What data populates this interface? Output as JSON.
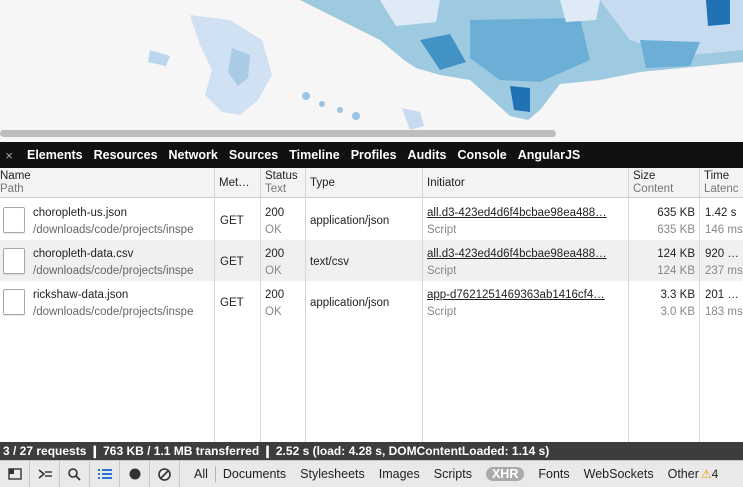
{
  "devtools": {
    "tabs": [
      "Elements",
      "Resources",
      "Network",
      "Sources",
      "Timeline",
      "Profiles",
      "Audits",
      "Console",
      "AngularJS"
    ],
    "close": "×"
  },
  "grid": {
    "headers": {
      "name": "Name",
      "name_sub": "Path",
      "method": "Met…",
      "status": "Status",
      "status_sub": "Text",
      "type": "Type",
      "initiator": "Initiator",
      "size": "Size",
      "size_sub": "Content",
      "time": "Time",
      "time_sub": "Latenc"
    },
    "rows": [
      {
        "name": "choropleth-us.json",
        "path": "/downloads/code/projects/inspe",
        "method": "GET",
        "status": "200",
        "status_text": "OK",
        "type": "application/json",
        "initiator": "all.d3-423ed4d6f4bcbae98ea488…",
        "initiator_type": "Script",
        "size": "635 KB",
        "content": "635 KB",
        "time": "1.42 s",
        "latency": "146 ms"
      },
      {
        "name": "choropleth-data.csv",
        "path": "/downloads/code/projects/inspe",
        "method": "GET",
        "status": "200",
        "status_text": "OK",
        "type": "text/csv",
        "initiator": "all.d3-423ed4d6f4bcbae98ea488…",
        "initiator_type": "Script",
        "size": "124 KB",
        "content": "124 KB",
        "time": "920 …",
        "latency": "237 ms"
      },
      {
        "name": "rickshaw-data.json",
        "path": "/downloads/code/projects/inspe",
        "method": "GET",
        "status": "200",
        "status_text": "OK",
        "type": "application/json",
        "initiator": "app-d7621251469363ab1416cf4…",
        "initiator_type": "Script",
        "size": "3.3 KB",
        "content": "3.0 KB",
        "time": "201 …",
        "latency": "183 ms"
      }
    ]
  },
  "status_bar": {
    "text": "3 / 27 requests  ❙  763 KB / 1.1 MB transferred  ❙  2.52 s (load: 4.28 s, DOMContentLoaded: 1.14 s)"
  },
  "bottom_bar": {
    "icons": [
      "dock-icon",
      "console-drawer-icon",
      "search-icon",
      "list-view-icon",
      "record-icon",
      "clear-icon"
    ],
    "filters": [
      "All",
      "Documents",
      "Stylesheets",
      "Images",
      "Scripts",
      "XHR",
      "Fonts",
      "WebSockets",
      "Other"
    ],
    "active_filter": "XHR",
    "warnings": "4"
  },
  "colors": {
    "map_light": "#c6dbef",
    "map_mid": "#6baed6",
    "map_dark": "#2171b5",
    "toolbar_bg": "#111111",
    "status_bg": "#3d3d3d"
  }
}
